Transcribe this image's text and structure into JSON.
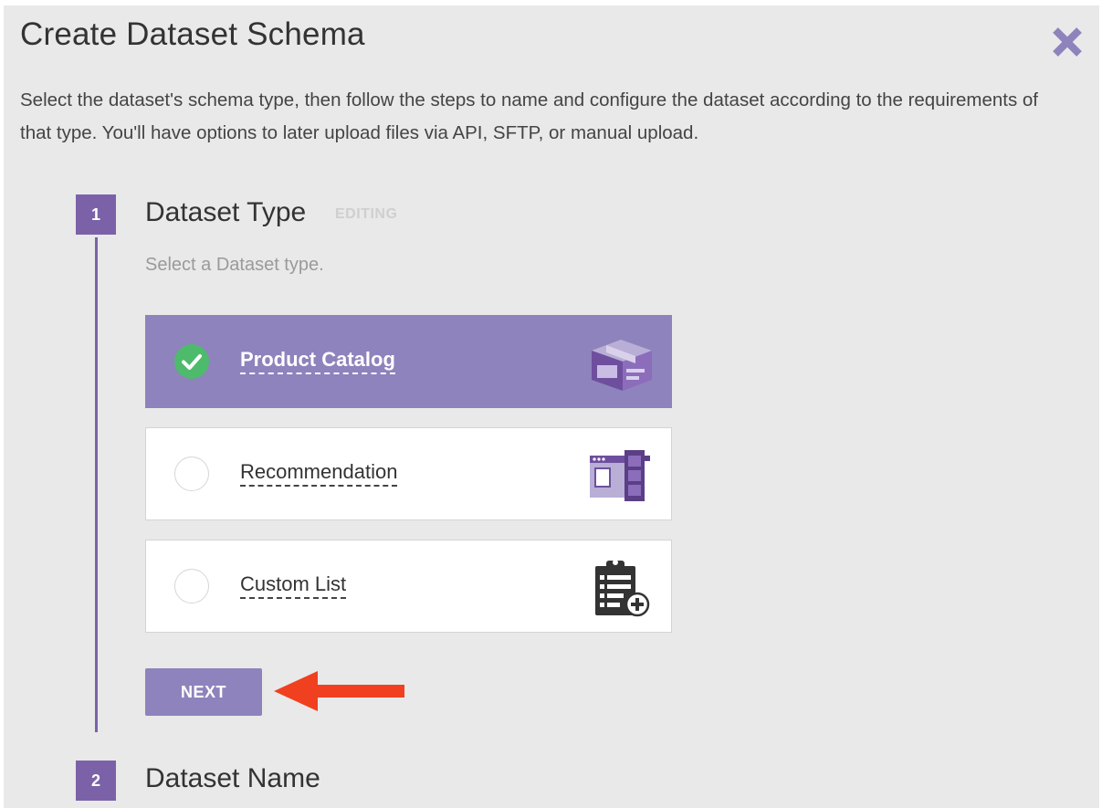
{
  "dialog": {
    "title": "Create Dataset Schema",
    "close_icon": "close-icon",
    "description": "Select the dataset's schema type, then follow the steps to name and configure the dataset according to the requirements of that type. You'll have options to later upload files via API, SFTP, or manual upload."
  },
  "steps": [
    {
      "number": "1",
      "title": "Dataset Type",
      "status": "EDITING",
      "subtitle": "Select a Dataset type.",
      "options": [
        {
          "label": "Product Catalog",
          "selected": true,
          "icon": "box-icon"
        },
        {
          "label": "Recommendation",
          "selected": false,
          "icon": "recommendation-panel-icon"
        },
        {
          "label": "Custom List",
          "selected": false,
          "icon": "clipboard-add-icon"
        }
      ],
      "next_label": "NEXT"
    },
    {
      "number": "2",
      "title": "Dataset Name"
    }
  ],
  "colors": {
    "accent": "#7b62a8",
    "selected_option": "#8e83bc",
    "check": "#4dbb6b",
    "arrow": "#f0401f",
    "background": "#e9e9e9"
  }
}
